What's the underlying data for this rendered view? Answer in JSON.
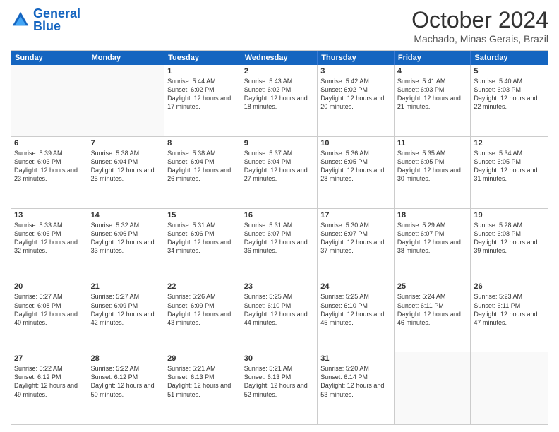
{
  "logo": {
    "line1": "General",
    "line2": "Blue"
  },
  "title": "October 2024",
  "location": "Machado, Minas Gerais, Brazil",
  "header_days": [
    "Sunday",
    "Monday",
    "Tuesday",
    "Wednesday",
    "Thursday",
    "Friday",
    "Saturday"
  ],
  "weeks": [
    [
      {
        "day": "",
        "empty": true
      },
      {
        "day": "",
        "empty": true
      },
      {
        "day": "1",
        "sunrise": "5:44 AM",
        "sunset": "6:02 PM",
        "daylight": "12 hours and 17 minutes."
      },
      {
        "day": "2",
        "sunrise": "5:43 AM",
        "sunset": "6:02 PM",
        "daylight": "12 hours and 18 minutes."
      },
      {
        "day": "3",
        "sunrise": "5:42 AM",
        "sunset": "6:02 PM",
        "daylight": "12 hours and 20 minutes."
      },
      {
        "day": "4",
        "sunrise": "5:41 AM",
        "sunset": "6:03 PM",
        "daylight": "12 hours and 21 minutes."
      },
      {
        "day": "5",
        "sunrise": "5:40 AM",
        "sunset": "6:03 PM",
        "daylight": "12 hours and 22 minutes."
      }
    ],
    [
      {
        "day": "6",
        "sunrise": "5:39 AM",
        "sunset": "6:03 PM",
        "daylight": "12 hours and 23 minutes."
      },
      {
        "day": "7",
        "sunrise": "5:38 AM",
        "sunset": "6:04 PM",
        "daylight": "12 hours and 25 minutes."
      },
      {
        "day": "8",
        "sunrise": "5:38 AM",
        "sunset": "6:04 PM",
        "daylight": "12 hours and 26 minutes."
      },
      {
        "day": "9",
        "sunrise": "5:37 AM",
        "sunset": "6:04 PM",
        "daylight": "12 hours and 27 minutes."
      },
      {
        "day": "10",
        "sunrise": "5:36 AM",
        "sunset": "6:05 PM",
        "daylight": "12 hours and 28 minutes."
      },
      {
        "day": "11",
        "sunrise": "5:35 AM",
        "sunset": "6:05 PM",
        "daylight": "12 hours and 30 minutes."
      },
      {
        "day": "12",
        "sunrise": "5:34 AM",
        "sunset": "6:05 PM",
        "daylight": "12 hours and 31 minutes."
      }
    ],
    [
      {
        "day": "13",
        "sunrise": "5:33 AM",
        "sunset": "6:06 PM",
        "daylight": "12 hours and 32 minutes."
      },
      {
        "day": "14",
        "sunrise": "5:32 AM",
        "sunset": "6:06 PM",
        "daylight": "12 hours and 33 minutes."
      },
      {
        "day": "15",
        "sunrise": "5:31 AM",
        "sunset": "6:06 PM",
        "daylight": "12 hours and 34 minutes."
      },
      {
        "day": "16",
        "sunrise": "5:31 AM",
        "sunset": "6:07 PM",
        "daylight": "12 hours and 36 minutes."
      },
      {
        "day": "17",
        "sunrise": "5:30 AM",
        "sunset": "6:07 PM",
        "daylight": "12 hours and 37 minutes."
      },
      {
        "day": "18",
        "sunrise": "5:29 AM",
        "sunset": "6:07 PM",
        "daylight": "12 hours and 38 minutes."
      },
      {
        "day": "19",
        "sunrise": "5:28 AM",
        "sunset": "6:08 PM",
        "daylight": "12 hours and 39 minutes."
      }
    ],
    [
      {
        "day": "20",
        "sunrise": "5:27 AM",
        "sunset": "6:08 PM",
        "daylight": "12 hours and 40 minutes."
      },
      {
        "day": "21",
        "sunrise": "5:27 AM",
        "sunset": "6:09 PM",
        "daylight": "12 hours and 42 minutes."
      },
      {
        "day": "22",
        "sunrise": "5:26 AM",
        "sunset": "6:09 PM",
        "daylight": "12 hours and 43 minutes."
      },
      {
        "day": "23",
        "sunrise": "5:25 AM",
        "sunset": "6:10 PM",
        "daylight": "12 hours and 44 minutes."
      },
      {
        "day": "24",
        "sunrise": "5:25 AM",
        "sunset": "6:10 PM",
        "daylight": "12 hours and 45 minutes."
      },
      {
        "day": "25",
        "sunrise": "5:24 AM",
        "sunset": "6:11 PM",
        "daylight": "12 hours and 46 minutes."
      },
      {
        "day": "26",
        "sunrise": "5:23 AM",
        "sunset": "6:11 PM",
        "daylight": "12 hours and 47 minutes."
      }
    ],
    [
      {
        "day": "27",
        "sunrise": "5:22 AM",
        "sunset": "6:12 PM",
        "daylight": "12 hours and 49 minutes."
      },
      {
        "day": "28",
        "sunrise": "5:22 AM",
        "sunset": "6:12 PM",
        "daylight": "12 hours and 50 minutes."
      },
      {
        "day": "29",
        "sunrise": "5:21 AM",
        "sunset": "6:13 PM",
        "daylight": "12 hours and 51 minutes."
      },
      {
        "day": "30",
        "sunrise": "5:21 AM",
        "sunset": "6:13 PM",
        "daylight": "12 hours and 52 minutes."
      },
      {
        "day": "31",
        "sunrise": "5:20 AM",
        "sunset": "6:14 PM",
        "daylight": "12 hours and 53 minutes."
      },
      {
        "day": "",
        "empty": true
      },
      {
        "day": "",
        "empty": true
      }
    ]
  ]
}
